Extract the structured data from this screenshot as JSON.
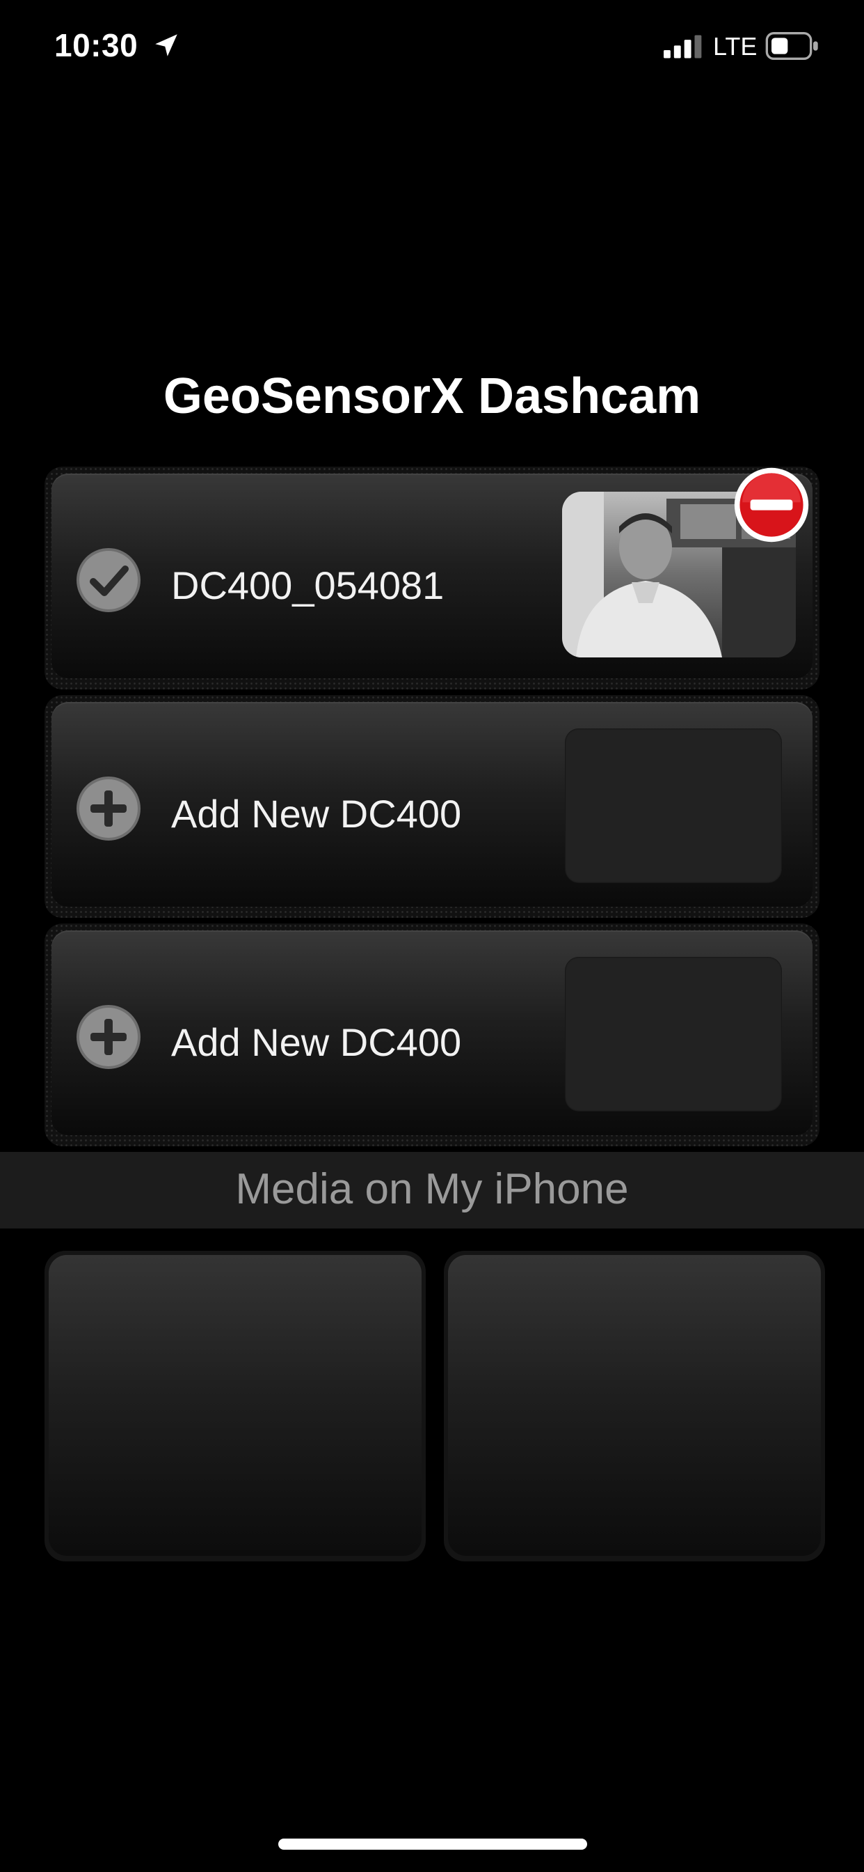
{
  "status_bar": {
    "time": "10:30",
    "network": "LTE",
    "icons": [
      "location-arrow-icon",
      "cellular-signal-icon",
      "battery-icon"
    ]
  },
  "app": {
    "title": "GeoSensorX Dashcam"
  },
  "devices": [
    {
      "label": "DC400_054081",
      "status": "connected",
      "icon": "checkmark-circle-icon",
      "has_thumbnail": true,
      "removable": true
    },
    {
      "label": "Add New DC400",
      "status": "empty",
      "icon": "plus-circle-icon",
      "has_thumbnail": false
    },
    {
      "label": "Add New DC400",
      "status": "empty",
      "icon": "plus-circle-icon",
      "has_thumbnail": false
    }
  ],
  "media": {
    "header": "Media on My iPhone",
    "tiles": 2
  },
  "colors": {
    "background": "#000000",
    "remove_badge": "#d8141a",
    "media_header_text": "#9a9a9a"
  }
}
